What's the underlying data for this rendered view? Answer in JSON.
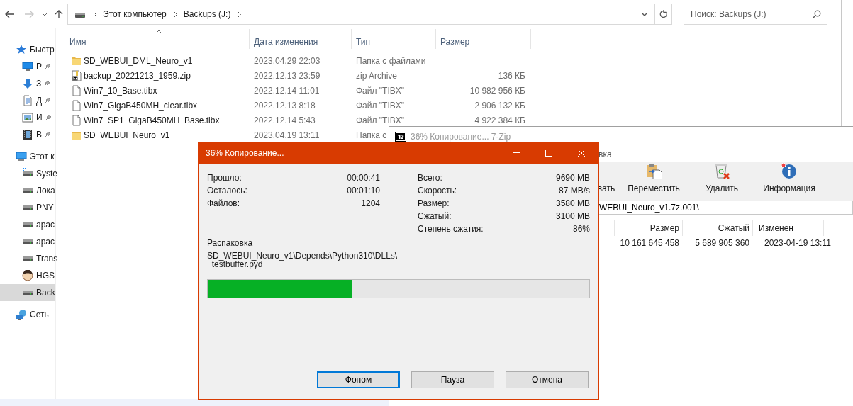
{
  "explorer": {
    "nav": {
      "forward_enabled": false,
      "breadcrumb": [
        "Этот компьютер",
        "Backups (J:)"
      ],
      "search_placeholder": "Поиск: Backups (J:)"
    },
    "sidebar": [
      {
        "label": "Быстр",
        "kind": "star",
        "selected": false,
        "children": [
          {
            "label": "Р",
            "kind": "desktop",
            "pinned": true,
            "selected": false
          },
          {
            "label": "З",
            "kind": "download",
            "pinned": true,
            "selected": false
          },
          {
            "label": "Д",
            "kind": "document",
            "pinned": true,
            "selected": false
          },
          {
            "label": "И",
            "kind": "pictures",
            "pinned": true,
            "selected": false
          },
          {
            "label": "В",
            "kind": "video",
            "pinned": true,
            "selected": false
          }
        ]
      },
      {
        "label": "Этот к",
        "kind": "computer",
        "selected": false,
        "children": [
          {
            "label": "Syste",
            "kind": "system-drive",
            "selected": false
          },
          {
            "label": "Лока",
            "kind": "drive",
            "selected": false
          },
          {
            "label": "PNY",
            "kind": "drive",
            "selected": false
          },
          {
            "label": "apac",
            "kind": "drive",
            "selected": false
          },
          {
            "label": "apac",
            "kind": "drive",
            "selected": false
          },
          {
            "label": "Trans",
            "kind": "drive",
            "selected": false
          },
          {
            "label": "HGS",
            "kind": "avatar",
            "selected": false
          },
          {
            "label": "Back",
            "kind": "drive",
            "selected": true
          }
        ]
      },
      {
        "label": "Сеть",
        "kind": "network",
        "selected": false
      }
    ],
    "columns": [
      {
        "label": "Имя",
        "sorted": true
      },
      {
        "label": "Дата изменения",
        "sorted": false
      },
      {
        "label": "Тип",
        "sorted": false
      },
      {
        "label": "Размер",
        "sorted": false
      }
    ],
    "rows": [
      {
        "kind": "folder",
        "name": "SD_WEBUI_DML_Neuro_v1",
        "date": "2023.04.29 22:03",
        "type": "Папка с файлами"
      },
      {
        "kind": "zip",
        "name": "backup_20221213_1959.zip",
        "date": "2022.12.13 23:59",
        "type": "zip Archive",
        "size": "136 КБ"
      },
      {
        "kind": "file",
        "name": "Win7_10_Base.tibx",
        "date": "2022.12.14 11:01",
        "type": "Файл \"TIBX\"",
        "size": "10 982 956 КБ"
      },
      {
        "kind": "file",
        "name": "Win7_GigaB450MH_clear.tibx",
        "date": "2022.12.13 8:18",
        "type": "Файл \"TIBX\"",
        "size": "2 906 132 КБ"
      },
      {
        "kind": "file",
        "name": "Win7_SP1_GigaB450MH_Base.tibx",
        "date": "2022.12.14 5:43",
        "type": "Файл \"TIBX\"",
        "size": "4 922 384 КБ"
      },
      {
        "kind": "folder",
        "name": "SD_WEBUI_Neuro_v1",
        "date": "2023.04.19 13:11",
        "type": "Папка с"
      }
    ]
  },
  "zip_window": {
    "title": "36% Копирование... 7-Zip",
    "menu": [
      "вка"
    ],
    "toolbar": [
      {
        "label": "вать",
        "kind": "none"
      },
      {
        "label": "Переместить",
        "kind": "move"
      },
      {
        "label": "Удалить",
        "kind": "delete"
      },
      {
        "label": "Информация",
        "kind": "info"
      }
    ],
    "path": "WEBUI_Neuro_v1.7z.001\\",
    "columns": [
      "Размер",
      "Сжатый",
      "Изменен"
    ],
    "rows": [
      [
        "10 161 645 458",
        "5 689 905 360",
        "2023-04-19 13:11"
      ]
    ]
  },
  "dialog": {
    "title": "36% Копирование...",
    "left_stats": [
      [
        "Прошло:",
        "00:00:41"
      ],
      [
        "Осталось:",
        "00:01:10"
      ],
      [
        "Файлов:",
        "1204"
      ]
    ],
    "right_stats": [
      [
        "Всего:",
        "9690 MB"
      ],
      [
        "Скорость:",
        "87 MB/s"
      ],
      [
        "Размер:",
        "3580 MB"
      ],
      [
        "Сжатый:",
        "3100 MB"
      ],
      [
        "Степень сжатия:",
        "86%"
      ]
    ],
    "operation": "Распаковка",
    "path_lines": [
      "SD_WEBUI_Neuro_v1\\Depends\\Python310\\DLLs\\",
      "_testbuffer.pyd"
    ],
    "progress": {
      "level": 0.378
    },
    "buttons": [
      {
        "label": "Фоном",
        "focused": true
      },
      {
        "label": "Пауза",
        "focused": false
      },
      {
        "label": "Отмена",
        "focused": false
      }
    ]
  }
}
